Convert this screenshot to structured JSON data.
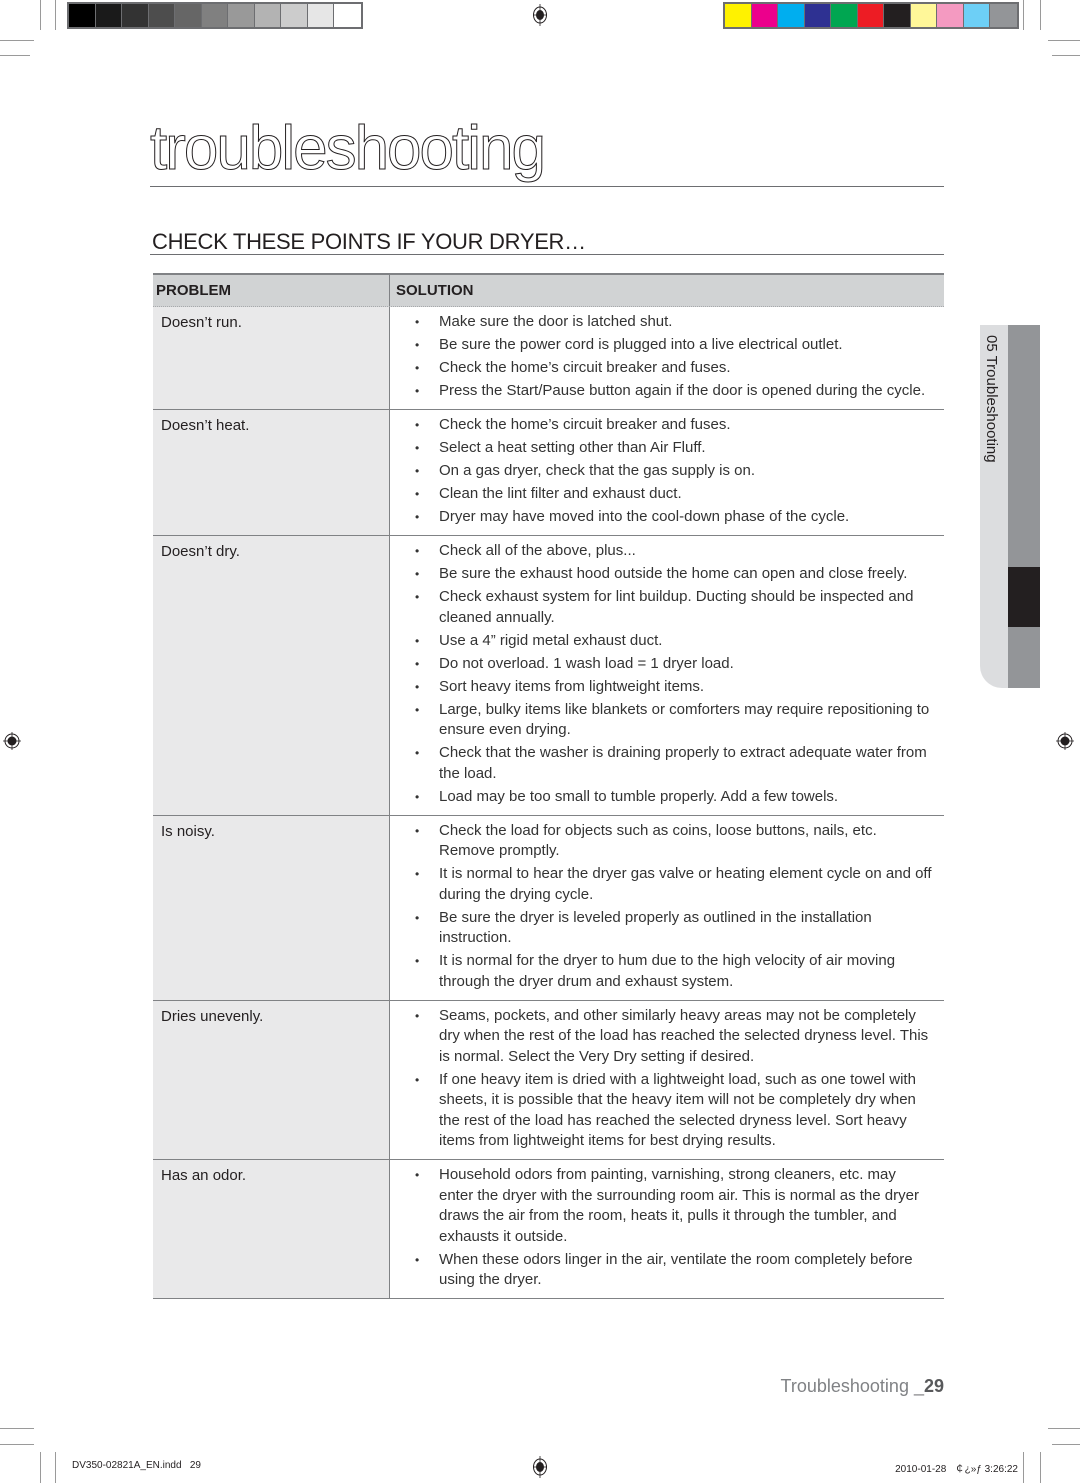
{
  "print_marks": {
    "grayscale_swatches": [
      "#000000",
      "#1a1a1a",
      "#333333",
      "#4d4d4d",
      "#666666",
      "#808080",
      "#999999",
      "#b3b3b3",
      "#cccccc",
      "#e6e6e6",
      "#ffffff"
    ],
    "color_swatches": [
      "#fff200",
      "#ec008c",
      "#00aeef",
      "#2e3192",
      "#00a651",
      "#ed1c24",
      "#231f20",
      "#fff799",
      "#f49ac1",
      "#6dcff6",
      "#939598"
    ]
  },
  "page": {
    "title": "troubleshooting",
    "section_title": "CHECK THESE POINTS IF YOUR DRYER…"
  },
  "table": {
    "headers": {
      "problem": "PROBLEM",
      "solution": "SOLUTION"
    },
    "rows": [
      {
        "problem": "Doesn’t run.",
        "solutions": [
          "Make sure the door is latched shut.",
          "Be sure the power cord is plugged into a live electrical outlet.",
          "Check the home’s circuit breaker and fuses.",
          "Press the Start/Pause button again if the door is opened during the cycle."
        ]
      },
      {
        "problem": "Doesn’t heat.",
        "solutions": [
          "Check the home’s circuit breaker and fuses.",
          "Select a heat setting other than Air Fluff.",
          "On a gas dryer, check that the gas supply is on.",
          "Clean the lint filter and exhaust duct.",
          "Dryer may have moved into the cool-down phase of the cycle."
        ]
      },
      {
        "problem": "Doesn’t dry.",
        "solutions": [
          "Check all of the above, plus...",
          "Be sure the exhaust hood outside the home can open and close freely.",
          "Check exhaust system for lint buildup. Ducting should be inspected and cleaned annually.",
          "Use a 4” rigid metal exhaust duct.",
          "Do not overload. 1 wash load = 1 dryer load.",
          "Sort heavy items from lightweight items.",
          "Large, bulky items like blankets or comforters may require repositioning to ensure even drying.",
          "Check that the washer is draining properly to extract adequate water from the load.",
          "Load may be too small to tumble properly. Add a few towels."
        ]
      },
      {
        "problem": "Is noisy.",
        "solutions": [
          "Check the load for objects such as coins, loose buttons, nails, etc. Remove promptly.",
          "It is normal to hear the dryer gas valve or heating element cycle on and off during the drying cycle.",
          "Be sure the dryer is leveled properly as outlined in the installation instruction.",
          "It is normal for the dryer to hum due to the high velocity of air moving through the dryer drum and exhaust system."
        ]
      },
      {
        "problem": "Dries unevenly.",
        "solutions": [
          "Seams, pockets, and other similarly heavy areas may not be completely dry when the rest of the load has reached the selected dryness level. This is normal. Select the Very Dry setting if desired.",
          "If one heavy item is dried with a lightweight load, such as one towel with sheets, it is possible that the heavy item will not be completely dry when the rest of the load has reached the selected dryness level. Sort heavy items from lightweight items for best drying results."
        ]
      },
      {
        "problem": "Has an odor.",
        "solutions": [
          "Household odors from painting, varnishing, strong cleaners, etc. may enter the dryer with the surrounding room air. This is normal as the dryer draws the air from the room, heats it, pulls it through the tumbler, and exhausts it outside.",
          "When these odors linger in the air, ventilate the room completely before using the dryer."
        ]
      }
    ]
  },
  "side_tab": {
    "label": "05 Troubleshooting"
  },
  "footer": {
    "section": "Troubleshooting _",
    "page_number": "29",
    "slug_left": "DV350-02821A_EN.indd   29",
    "slug_right": "2010-01-28   ￠¿»ƒ 3:26:22"
  }
}
